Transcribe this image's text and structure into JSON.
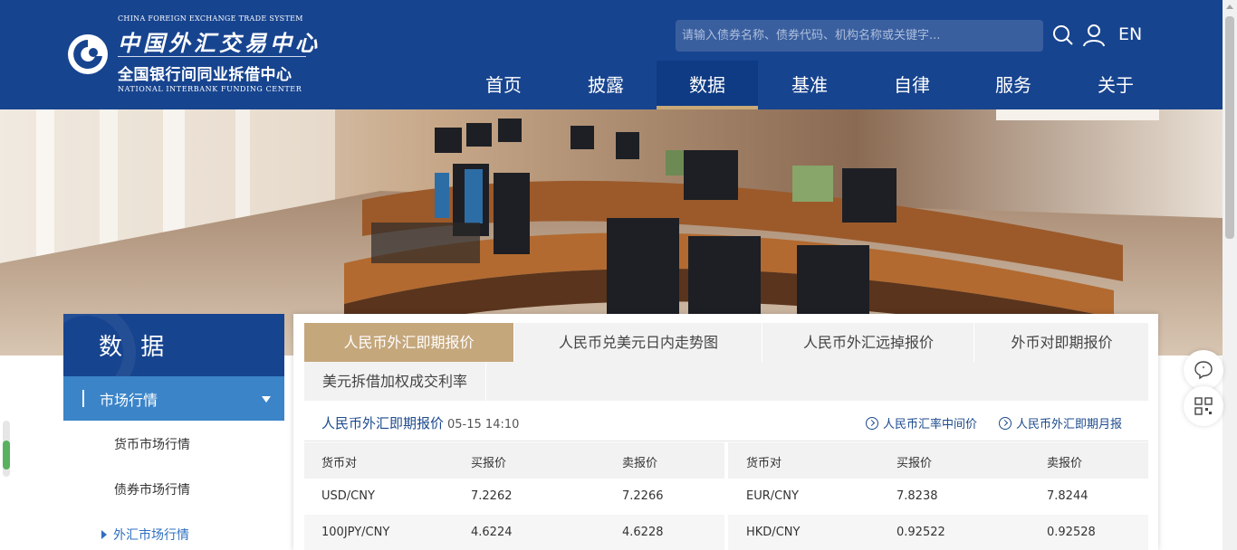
{
  "header": {
    "logo_en_top": "CHINA FOREIGN EXCHANGE TRADE SYSTEM",
    "logo_cn_main": "中国外汇交易中心",
    "logo_cn_sub": "全国银行间同业拆借中心",
    "logo_en_bottom": "NATIONAL INTERBANK FUNDING CENTER",
    "search_placeholder": "请输入债券名称、债券代码、机构名称或关键字...",
    "search_icon": "search-icon",
    "user_icon": "user-icon",
    "lang": "EN",
    "nav": [
      {
        "label": "首页"
      },
      {
        "label": "披露"
      },
      {
        "label": "数据",
        "active": true
      },
      {
        "label": "基准"
      },
      {
        "label": "自律"
      },
      {
        "label": "服务"
      },
      {
        "label": "关于"
      }
    ],
    "bg_color": "#17448f",
    "accent_color": "#c5a77c"
  },
  "sidebar": {
    "title": "数 据",
    "active_section": "市场行情",
    "items": [
      {
        "label": "货币市场行情"
      },
      {
        "label": "债券市场行情"
      },
      {
        "label": "外汇市场行情",
        "current": true
      }
    ]
  },
  "main": {
    "tabs": [
      {
        "label": "人民币外汇即期报价",
        "active": true
      },
      {
        "label": "人民币兑美元日内走势图"
      },
      {
        "label": "人民币外汇远掉报价"
      },
      {
        "label": "外币对即期报价"
      },
      {
        "label": "美元拆借加权成交利率"
      }
    ],
    "section_title": "人民币外汇即期报价",
    "section_time": "05-15 14:10",
    "links": [
      {
        "label": "人民币汇率中间价"
      },
      {
        "label": "人民币外汇即期月报"
      }
    ],
    "table_headers": [
      "货币对",
      "买报价",
      "卖报价"
    ],
    "left_rows": [
      {
        "pair": "USD/CNY",
        "bid": "7.2262",
        "ask": "7.2266"
      },
      {
        "pair": "100JPY/CNY",
        "bid": "4.6224",
        "ask": "4.6228"
      }
    ],
    "right_rows": [
      {
        "pair": "EUR/CNY",
        "bid": "7.8238",
        "ask": "7.8244"
      },
      {
        "pair": "HKD/CNY",
        "bid": "0.92522",
        "ask": "0.92528"
      }
    ]
  },
  "floating": {
    "chat_icon": "chat-bubble-icon",
    "qr_icon": "qr-code-icon"
  }
}
